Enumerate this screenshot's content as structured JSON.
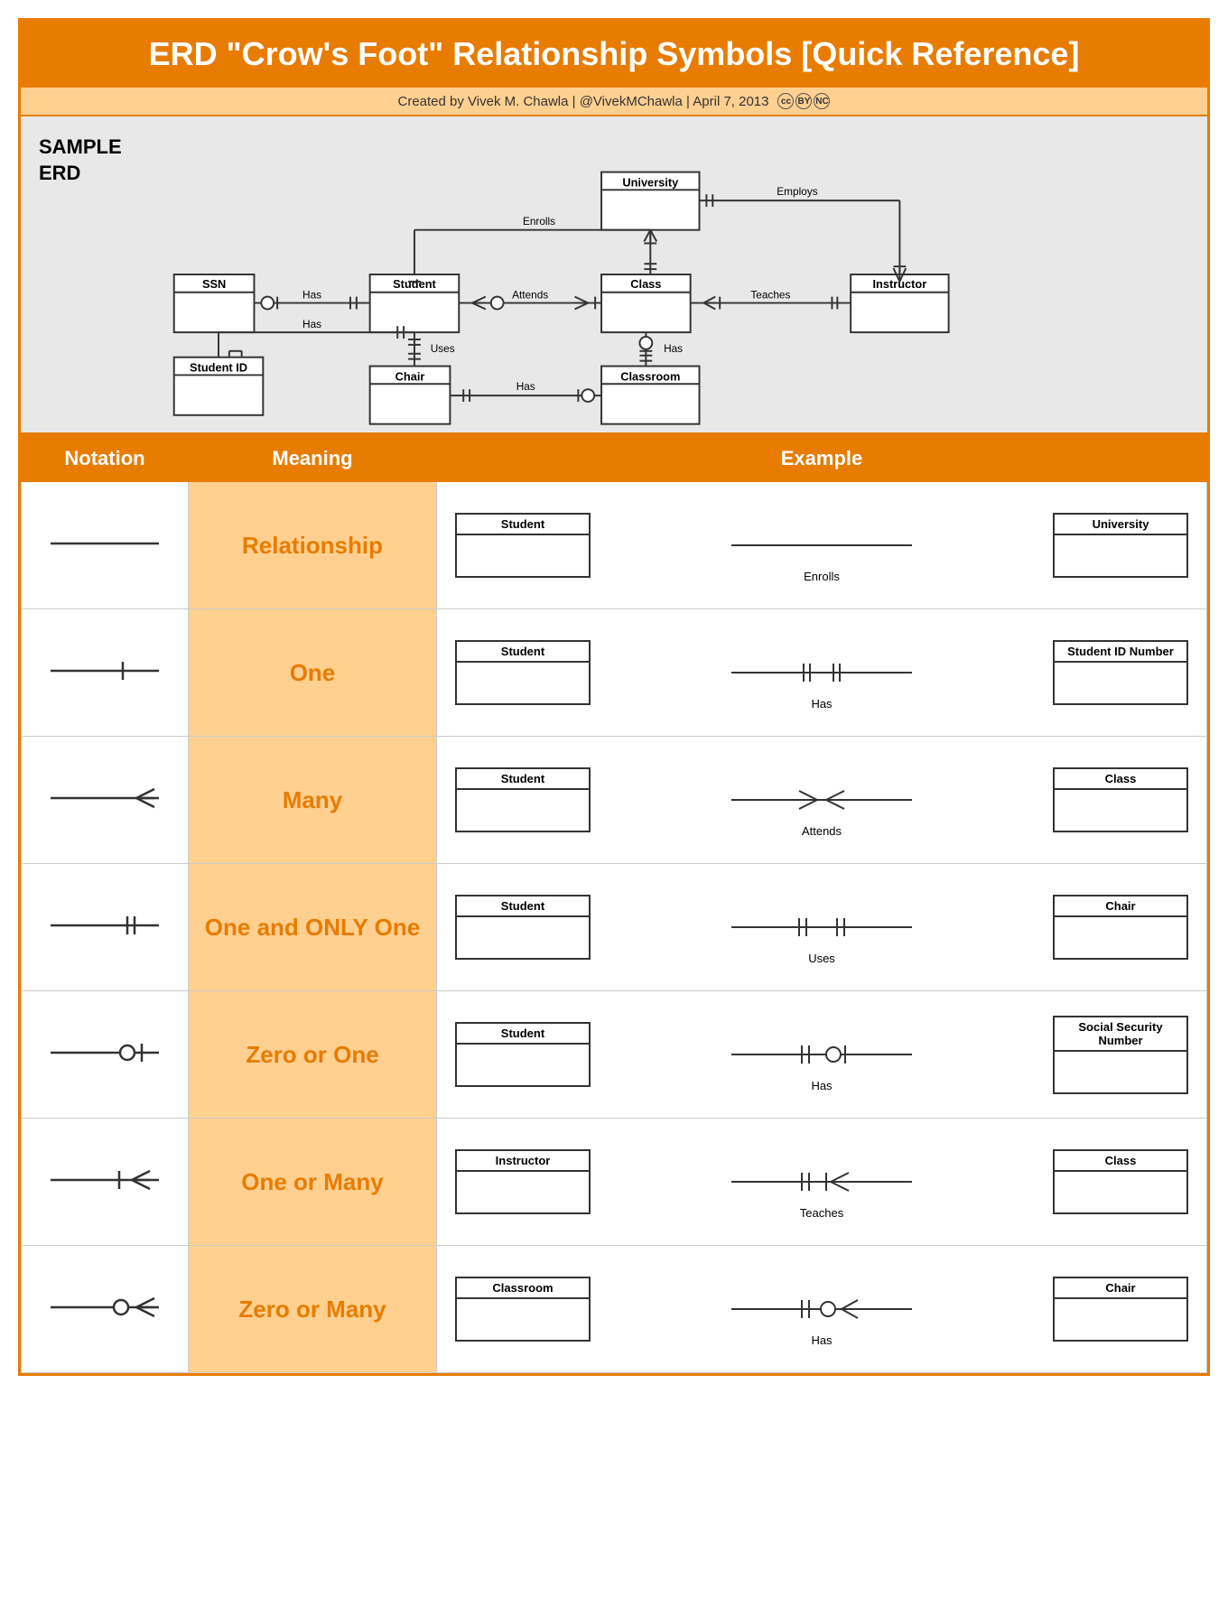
{
  "title": "ERD \"Crow's Foot\" Relationship Symbols [Quick Reference]",
  "subtitle": "Created by Vivek M. Chawla | @VivekMChawla | April 7, 2013",
  "erd_label": "SAMPLE\nERD",
  "table": {
    "headers": [
      "Notation",
      "Meaning",
      "Example"
    ],
    "rows": [
      {
        "notation": "relationship",
        "meaning": "Relationship",
        "example_left": "Student",
        "example_right": "University",
        "example_label": "Enrolls"
      },
      {
        "notation": "one",
        "meaning": "One",
        "example_left": "Student",
        "example_right": "Student ID Number",
        "example_label": "Has"
      },
      {
        "notation": "many",
        "meaning": "Many",
        "example_left": "Student",
        "example_right": "Class",
        "example_label": "Attends"
      },
      {
        "notation": "one_and_only_one",
        "meaning": "One and ONLY One",
        "example_left": "Student",
        "example_right": "Chair",
        "example_label": "Uses"
      },
      {
        "notation": "zero_or_one",
        "meaning": "Zero or One",
        "example_left": "Student",
        "example_right": "Social Security Number",
        "example_label": "Has"
      },
      {
        "notation": "one_or_many",
        "meaning": "One or Many",
        "example_left": "Instructor",
        "example_right": "Class",
        "example_label": "Teaches"
      },
      {
        "notation": "zero_or_many",
        "meaning": "Zero or Many",
        "example_left": "Classroom",
        "example_right": "Chair",
        "example_label": "Has"
      }
    ]
  }
}
